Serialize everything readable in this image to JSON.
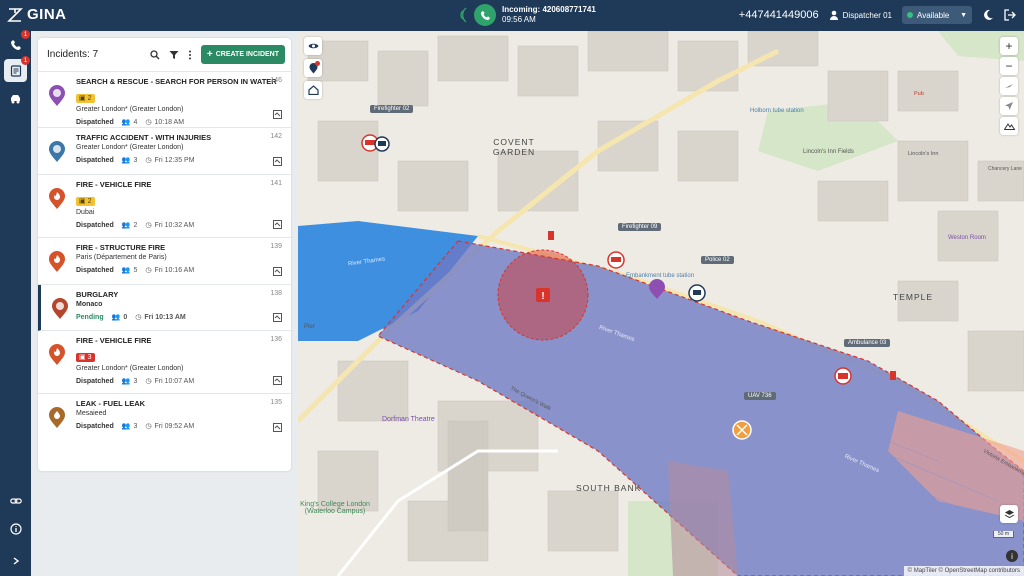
{
  "app": {
    "name": "GINA"
  },
  "call": {
    "incoming_label": "Incoming: 420608771741",
    "time": "09:56 AM"
  },
  "topbar": {
    "phone": "+447441449006",
    "dispatcher": "Dispatcher 01",
    "status": "Available"
  },
  "sidebar": {
    "phone_badge": "1",
    "incidents_badge": "1"
  },
  "panel": {
    "title": "Incidents:",
    "count": "7",
    "create_label": "CREATE INCIDENT"
  },
  "incidents": [
    {
      "title": "SEARCH & RESCUE - SEARCH FOR PERSON IN WATER",
      "num": "146",
      "priority": "2",
      "location": "Greater London* (Greater London)",
      "status": "Dispatched",
      "units": "4",
      "time": "10:18 AM"
    },
    {
      "title": "TRAFFIC ACCIDENT - WITH INJURIES",
      "num": "142",
      "location": "Greater London* (Greater London)",
      "status": "Dispatched",
      "units": "3",
      "time": "Fri 12:35 PM"
    },
    {
      "title": "FIRE - VEHICLE FIRE",
      "num": "141",
      "priority": "2",
      "location": "Dubai",
      "status": "Dispatched",
      "units": "2",
      "time": "Fri 10:32 AM"
    },
    {
      "title": "FIRE - STRUCTURE FIRE",
      "num": "139",
      "location": "Paris (Département de Paris)",
      "status": "Dispatched",
      "units": "5",
      "time": "Fri 10:16 AM"
    },
    {
      "title": "BURGLARY",
      "num": "138",
      "location": "Monaco",
      "status": "Pending",
      "units": "0",
      "time": "Fri 10:13 AM"
    },
    {
      "title": "FIRE - VEHICLE FIRE",
      "num": "136",
      "priority": "3",
      "location": "Greater London* (Greater London)",
      "status": "Dispatched",
      "units": "3",
      "time": "Fri 10:07 AM"
    },
    {
      "title": "LEAK - FUEL LEAK",
      "num": "135",
      "location": "Mesaieed",
      "status": "Dispatched",
      "units": "3",
      "time": "Fri 09:52 AM"
    }
  ],
  "map": {
    "units": [
      "Firefighter 02",
      "Firefighter 09",
      "Police 02",
      "Ambulance 03",
      "UAV 736"
    ],
    "labels": {
      "covent": "COVENT GARDEN",
      "temple": "TEMPLE",
      "southbank": "SOUTH BANK",
      "kings": "King's College London (Waterloo Campus)",
      "dorfman": "Dorfman Theatre",
      "embankment": "Embankment tube station",
      "lincoln": "Lincoln's Inn Fields",
      "holborn": "Holborn tube station",
      "weston": "Weston Room",
      "chancery": "Chancery Lane",
      "pier": "Pier",
      "queens": "The Queen's Walk",
      "thames1": "River Thames",
      "thames2": "River Thames",
      "thames3": "River Thames",
      "pub": "Pub",
      "victoria": "Victoria Embankment",
      "lincoln2": "Lincoln's Inn"
    },
    "scale": "50 m",
    "attribution": "© MapTiler © OpenStreetMap contributors"
  },
  "colors": {
    "nav": "#1f3a58",
    "accent": "#2b8a63",
    "danger": "#d9342b",
    "warning": "#f1c232",
    "zone": "#6d78c4"
  }
}
